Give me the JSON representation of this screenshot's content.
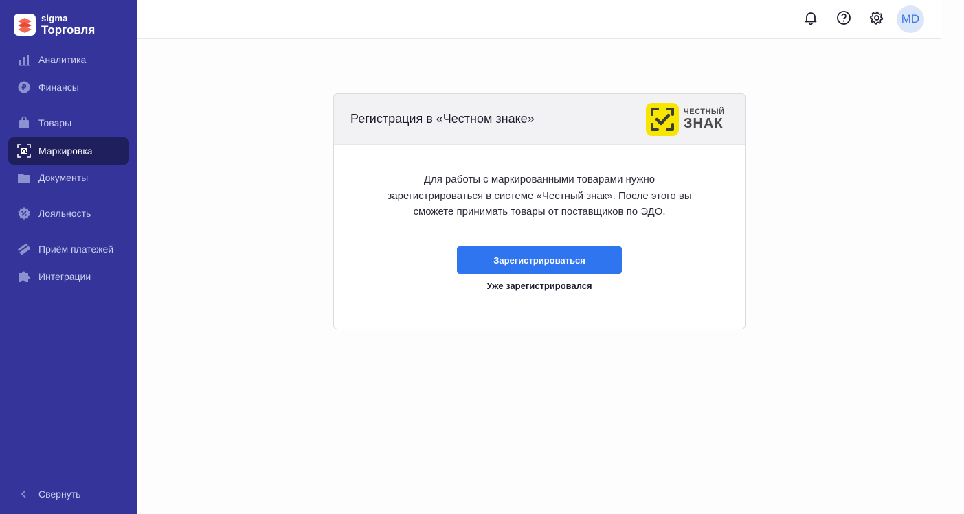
{
  "app": {
    "brand_small": "sigma",
    "brand_big": "Торговля"
  },
  "sidebar": {
    "items": [
      {
        "label": "Аналитика",
        "icon": "bar-chart-icon",
        "active": false
      },
      {
        "label": "Финансы",
        "icon": "ruble-coin-icon",
        "active": false
      },
      {
        "label": "Товары",
        "icon": "shopping-bag-icon",
        "active": false
      },
      {
        "label": "Маркировка",
        "icon": "datamatrix-scan-icon",
        "active": true
      },
      {
        "label": "Документы",
        "icon": "folder-icon",
        "active": false
      },
      {
        "label": "Лояльность",
        "icon": "discount-badge-icon",
        "active": false
      },
      {
        "label": "Приём платежей",
        "icon": "payment-card-icon",
        "active": false
      },
      {
        "label": "Интеграции",
        "icon": "puzzle-icon",
        "active": false
      }
    ],
    "collapse_label": "Свернуть"
  },
  "header": {
    "icons": [
      "bell-icon",
      "help-icon",
      "gear-icon"
    ],
    "avatar_initials": "MD"
  },
  "card": {
    "title": "Регистрация в «Честном знаке»",
    "partner_logo": {
      "line1": "ЧЕСТНЫЙ",
      "line2": "ЗНАК",
      "color": "#f6e600"
    },
    "text_lines": [
      "Для работы с маркированными товарами нужно",
      "зарегистрироваться в системе «Честный знак». После этого вы",
      "сможете принимать товары от поставщиков по ЭДО."
    ],
    "primary_button": "Зарегистрироваться",
    "secondary_link": "Уже зарегистрировался"
  },
  "colors": {
    "sidebar_bg": "#35349a",
    "sidebar_active_bg": "#1f1f5e",
    "primary": "#2f75f0",
    "avatar_bg": "#dce6fb"
  }
}
